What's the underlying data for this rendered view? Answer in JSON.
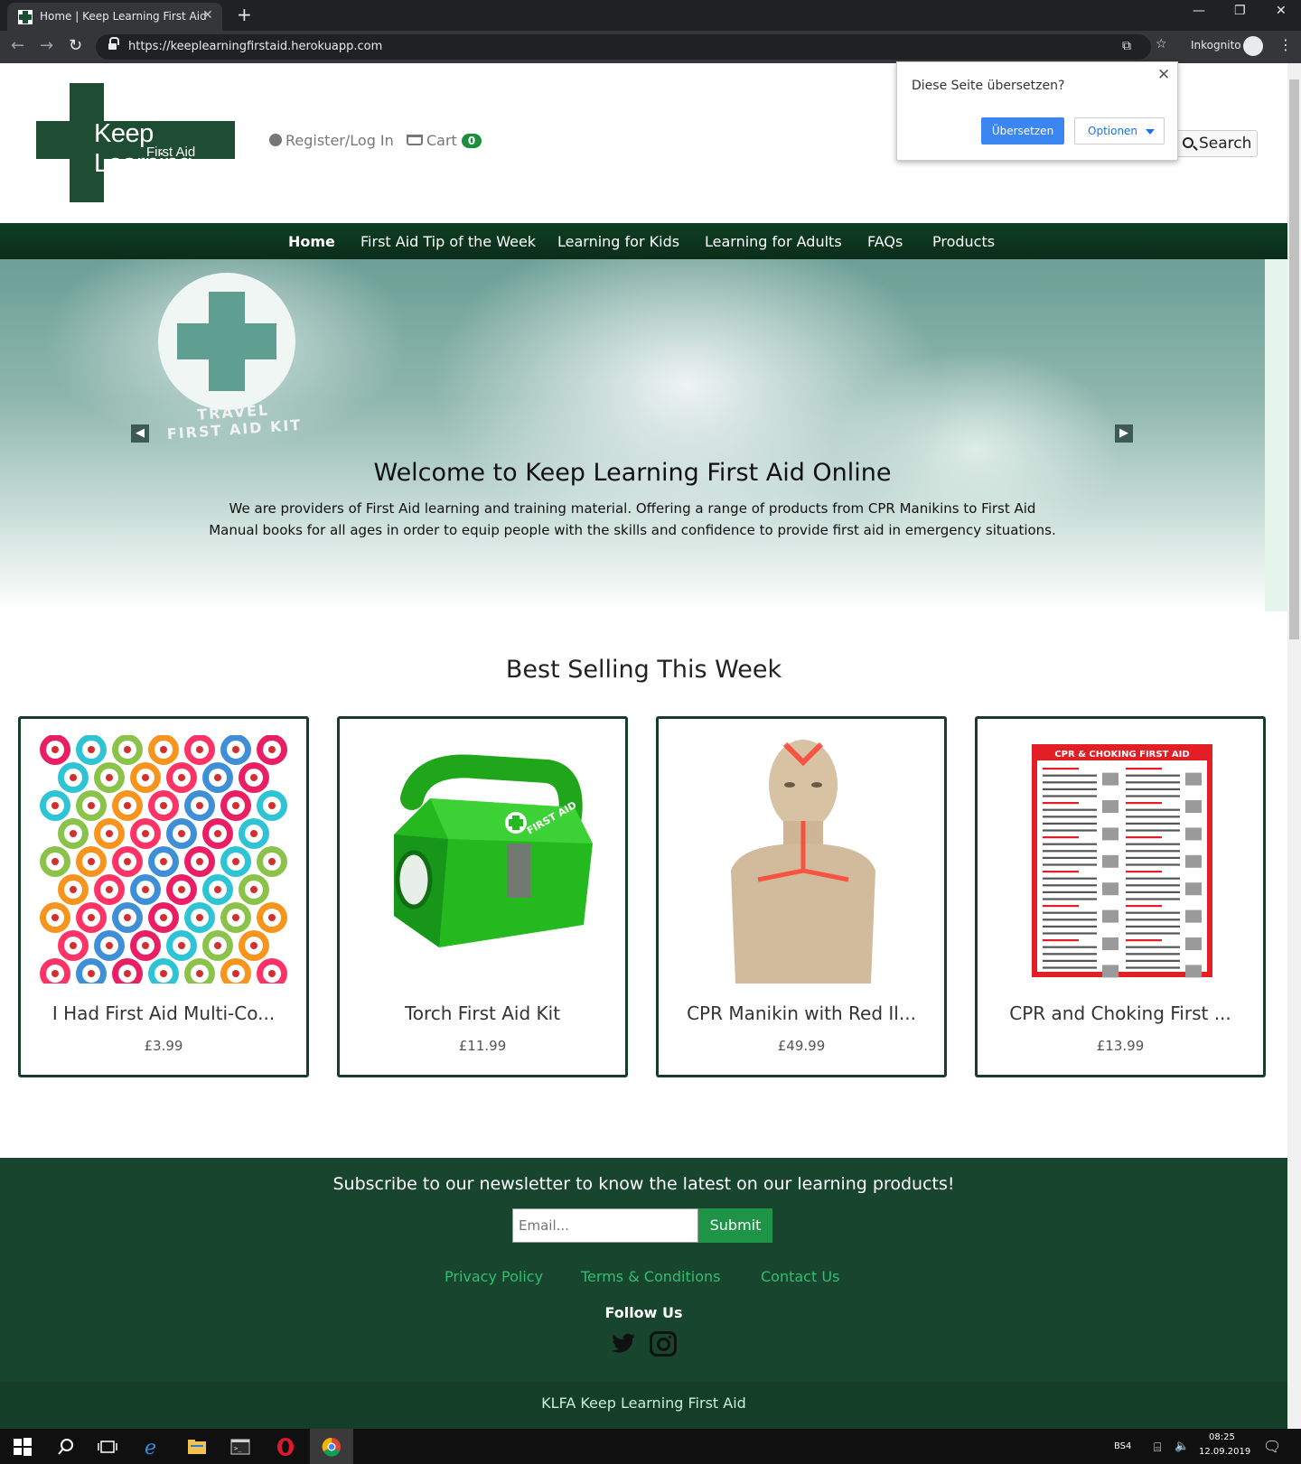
{
  "browser": {
    "tab_title": "Home | Keep Learning First Aid",
    "tab_close": "✕",
    "new_tab": "+",
    "url": "https://keeplearningfirstaid.herokuapp.com",
    "incognito_label": "Inkognito",
    "window_controls": [
      "—",
      "❐",
      "✕"
    ]
  },
  "translate_popup": {
    "question": "Diese Seite übersetzen?",
    "translate_label": "Übersetzen",
    "options_label": "Optionen",
    "close": "✕"
  },
  "header": {
    "logo_line1": "Keep Learning",
    "logo_line2": "First Aid",
    "register_label": "Register/Log In",
    "cart_label": "Cart",
    "cart_count": "0",
    "search_label": "Search"
  },
  "nav": {
    "items": [
      {
        "label": "Home",
        "active": true
      },
      {
        "label": "First Aid Tip of the Week"
      },
      {
        "label": "Learning for Kids"
      },
      {
        "label": "Learning for Adults"
      },
      {
        "label": "FAQs"
      },
      {
        "label": "Products"
      }
    ]
  },
  "hero": {
    "kit_line1": "TRAVEL",
    "kit_line2": "FIRST AID KIT",
    "title": "Welcome to Keep Learning First Aid Online",
    "text": "We are providers of First Aid learning and training material. Offering a range of products from CPR Manikins to First Aid Manual books for all ages in order to equip people with the skills and confidence to provide first aid in emergency situations.",
    "prev_arrow": "◀",
    "next_arrow": "▶"
  },
  "best_selling": {
    "title": "Best Selling This Week",
    "products": [
      {
        "title": "I Had First Aid Multi-Co...",
        "price": "£3.99"
      },
      {
        "title": "Torch First Aid Kit",
        "price": "£11.99"
      },
      {
        "title": "CPR Manikin with Red Il...",
        "price": "£49.99"
      },
      {
        "title": "CPR and Choking First ...",
        "price": "£13.99"
      }
    ],
    "poster_title": "CPR & CHOKING FIRST AID",
    "lunchbox_label": "FIRST AID"
  },
  "footer": {
    "newsletter_title": "Subscribe to our newsletter to know the latest on our learning products!",
    "email_placeholder": "Email...",
    "submit_label": "Submit",
    "links": [
      "Privacy Policy",
      "Terms & Conditions",
      "Contact Us"
    ],
    "follow_label": "Follow Us",
    "copyright": "KLFA Keep Learning First Aid"
  },
  "taskbar": {
    "lang": "BS4",
    "time": "08:25",
    "date": "12.09.2019"
  },
  "colors": {
    "brand_green": "#17452d",
    "nav_green": "#0e3f23",
    "accent_green": "#1e9446",
    "link_green": "#2fbf72"
  }
}
